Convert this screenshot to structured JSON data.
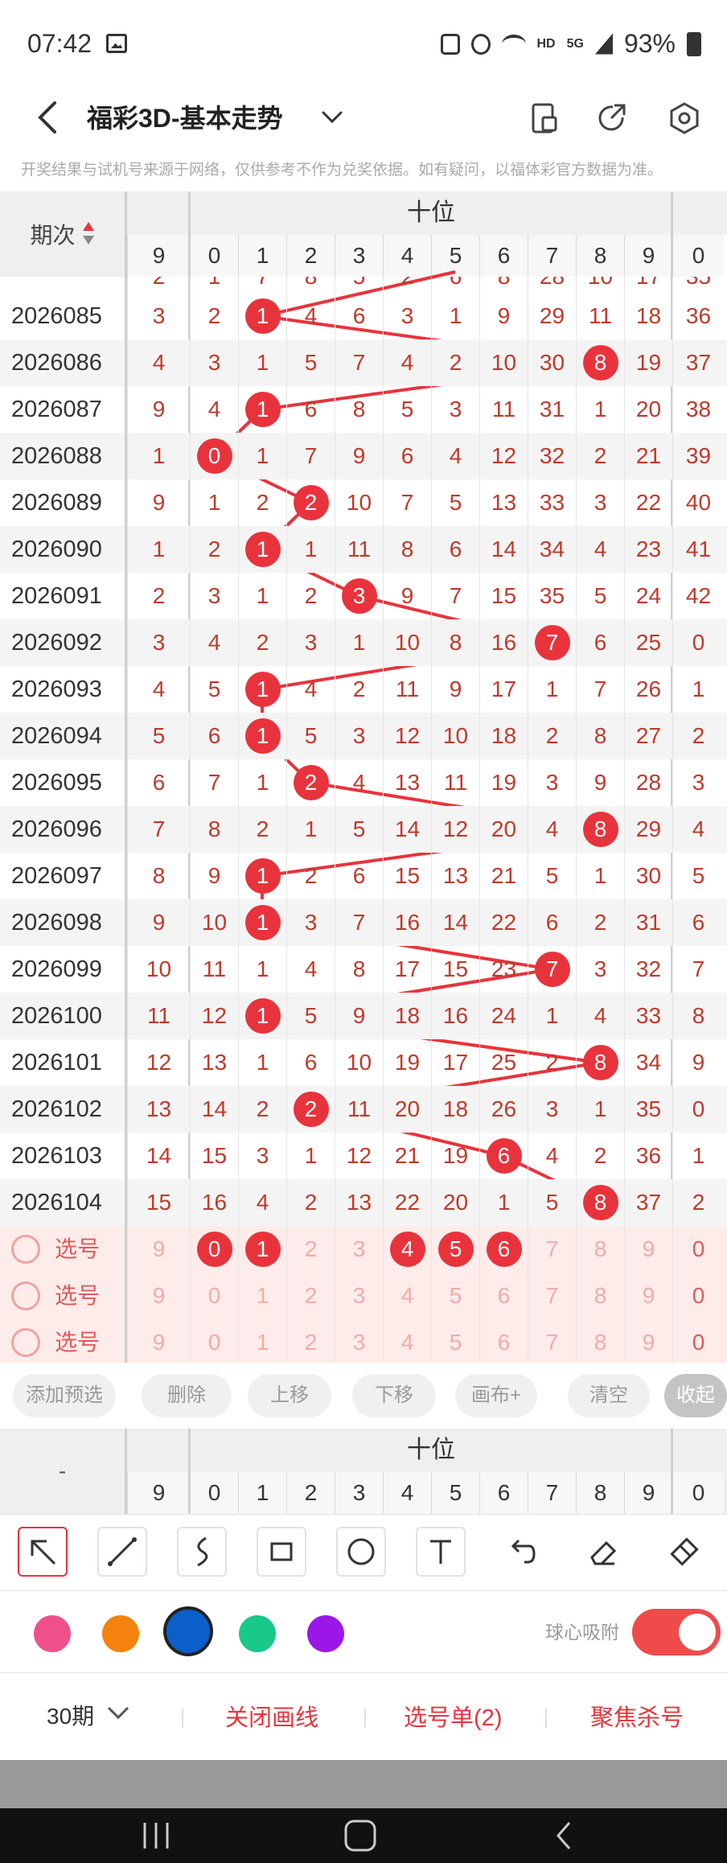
{
  "status_bar": {
    "time": "07:42",
    "network": "HD",
    "signal": "5G",
    "battery": "93%"
  },
  "header": {
    "title": "福彩3D-基本走势"
  },
  "notice": "开奖结果与试机号来源于网络，仅供参考不作为兑奖依据。如有疑问，以福体彩官方数据为准。",
  "table": {
    "issue_header": "期次",
    "group_label": "十位",
    "digit_headers": [
      "9",
      "0",
      "1",
      "2",
      "3",
      "4",
      "5",
      "6",
      "7",
      "8",
      "9",
      "0"
    ],
    "partial_row": [
      "2",
      "1",
      "7",
      "8",
      "5",
      "2",
      "6",
      "8",
      "28",
      "10",
      "17",
      "35"
    ],
    "rows": [
      {
        "issue": "2026085",
        "cells": [
          "3",
          "2",
          "1",
          "4",
          "6",
          "3",
          "1",
          "9",
          "29",
          "11",
          "18",
          "36"
        ],
        "hit": 1
      },
      {
        "issue": "2026086",
        "cells": [
          "4",
          "3",
          "1",
          "5",
          "7",
          "4",
          "2",
          "10",
          "30",
          "8",
          "19",
          "37"
        ],
        "hit": 8
      },
      {
        "issue": "2026087",
        "cells": [
          "9",
          "4",
          "1",
          "6",
          "8",
          "5",
          "3",
          "11",
          "31",
          "1",
          "20",
          "38"
        ],
        "hit": 1
      },
      {
        "issue": "2026088",
        "cells": [
          "1",
          "0",
          "1",
          "7",
          "9",
          "6",
          "4",
          "12",
          "32",
          "2",
          "21",
          "39"
        ],
        "hit": 0
      },
      {
        "issue": "2026089",
        "cells": [
          "9",
          "1",
          "2",
          "2",
          "10",
          "7",
          "5",
          "13",
          "33",
          "3",
          "22",
          "40"
        ],
        "hit": 2
      },
      {
        "issue": "2026090",
        "cells": [
          "1",
          "2",
          "1",
          "1",
          "11",
          "8",
          "6",
          "14",
          "34",
          "4",
          "23",
          "41"
        ],
        "hit": 1
      },
      {
        "issue": "2026091",
        "cells": [
          "2",
          "3",
          "1",
          "2",
          "3",
          "9",
          "7",
          "15",
          "35",
          "5",
          "24",
          "42"
        ],
        "hit": 3
      },
      {
        "issue": "2026092",
        "cells": [
          "3",
          "4",
          "2",
          "3",
          "1",
          "10",
          "8",
          "16",
          "7",
          "6",
          "25",
          "0"
        ],
        "hit": 7
      },
      {
        "issue": "2026093",
        "cells": [
          "4",
          "5",
          "1",
          "4",
          "2",
          "11",
          "9",
          "17",
          "1",
          "7",
          "26",
          "1"
        ],
        "hit": 1
      },
      {
        "issue": "2026094",
        "cells": [
          "5",
          "6",
          "1",
          "5",
          "3",
          "12",
          "10",
          "18",
          "2",
          "8",
          "27",
          "2"
        ],
        "hit": 1
      },
      {
        "issue": "2026095",
        "cells": [
          "6",
          "7",
          "1",
          "2",
          "4",
          "13",
          "11",
          "19",
          "3",
          "9",
          "28",
          "3"
        ],
        "hit": 2
      },
      {
        "issue": "2026096",
        "cells": [
          "7",
          "8",
          "2",
          "1",
          "5",
          "14",
          "12",
          "20",
          "4",
          "8",
          "29",
          "4"
        ],
        "hit": 8
      },
      {
        "issue": "2026097",
        "cells": [
          "8",
          "9",
          "1",
          "2",
          "6",
          "15",
          "13",
          "21",
          "5",
          "1",
          "30",
          "5"
        ],
        "hit": 1
      },
      {
        "issue": "2026098",
        "cells": [
          "9",
          "10",
          "1",
          "3",
          "7",
          "16",
          "14",
          "22",
          "6",
          "2",
          "31",
          "6"
        ],
        "hit": 1
      },
      {
        "issue": "2026099",
        "cells": [
          "10",
          "11",
          "1",
          "4",
          "8",
          "17",
          "15",
          "23",
          "7",
          "3",
          "32",
          "7"
        ],
        "hit": 7
      },
      {
        "issue": "2026100",
        "cells": [
          "11",
          "12",
          "1",
          "5",
          "9",
          "18",
          "16",
          "24",
          "1",
          "4",
          "33",
          "8"
        ],
        "hit": 1
      },
      {
        "issue": "2026101",
        "cells": [
          "12",
          "13",
          "1",
          "6",
          "10",
          "19",
          "17",
          "25",
          "2",
          "8",
          "34",
          "9"
        ],
        "hit": 8
      },
      {
        "issue": "2026102",
        "cells": [
          "13",
          "14",
          "2",
          "2",
          "11",
          "20",
          "18",
          "26",
          "3",
          "1",
          "35",
          "0"
        ],
        "hit": 2
      },
      {
        "issue": "2026103",
        "cells": [
          "14",
          "15",
          "3",
          "1",
          "12",
          "21",
          "19",
          "6",
          "4",
          "2",
          "36",
          "1"
        ],
        "hit": 6
      },
      {
        "issue": "2026104",
        "cells": [
          "15",
          "16",
          "4",
          "2",
          "13",
          "22",
          "20",
          "1",
          "5",
          "8",
          "37",
          "2"
        ],
        "hit": 8
      }
    ],
    "select_label": "选号",
    "select_rows": [
      {
        "cells": [
          "9",
          "0",
          "1",
          "2",
          "3",
          "4",
          "5",
          "6",
          "7",
          "8",
          "9",
          "0"
        ],
        "picked": [
          "0",
          "1",
          "4",
          "5",
          "6"
        ]
      },
      {
        "cells": [
          "9",
          "0",
          "1",
          "2",
          "3",
          "4",
          "5",
          "6",
          "7",
          "8",
          "9",
          "0"
        ],
        "picked": []
      },
      {
        "cells": [
          "9",
          "0",
          "1",
          "2",
          "3",
          "4",
          "5",
          "6",
          "7",
          "8",
          "9",
          "0"
        ],
        "picked": []
      }
    ]
  },
  "actions": [
    "添加预选",
    "删除",
    "上移",
    "下移",
    "画布+",
    "清空",
    "收起"
  ],
  "table2": {
    "dash": "-",
    "group_label": "十位",
    "digit_headers": [
      "9",
      "0",
      "1",
      "2",
      "3",
      "4",
      "5",
      "6",
      "7",
      "8",
      "9",
      "0"
    ]
  },
  "tools": [
    "arrow-tool-icon",
    "line-tool-icon",
    "curve-tool-icon",
    "rect-tool-icon",
    "circle-tool-icon",
    "text-tool-icon",
    "undo-icon",
    "eraser-icon",
    "clear-brush-icon"
  ],
  "palette": [
    "#f0508a",
    "#f5820d",
    "#0a5fc8",
    "#18c98a",
    "#9a17e8"
  ],
  "snap_label": "球心吸附",
  "bottom": {
    "period": "30期",
    "close_lines": "关闭画线",
    "pick_list": "选号单(2)",
    "focus_kill": "聚焦杀号"
  },
  "colors": {
    "accent": "#e8333c",
    "ball": "#e8333c",
    "arrow": "#1560c9"
  }
}
